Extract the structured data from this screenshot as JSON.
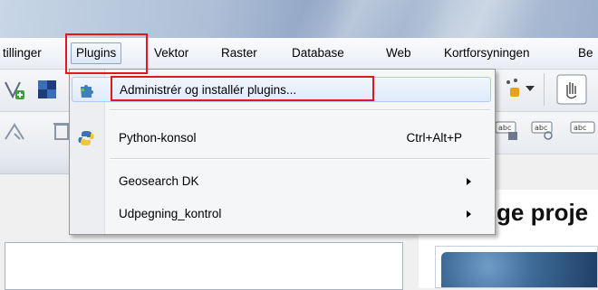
{
  "menubar": {
    "items": [
      {
        "label": "tillinger"
      },
      {
        "label": "Plugins"
      },
      {
        "label": "Vektor"
      },
      {
        "label": "Raster"
      },
      {
        "label": "Database"
      },
      {
        "label": "Web"
      },
      {
        "label": "Kortforsyningen"
      },
      {
        "label": "Be"
      }
    ]
  },
  "plugins_menu": {
    "items": [
      {
        "label": "Administrér og installér plugins...",
        "icon": "puzzle-icon"
      },
      {
        "label": "Python-konsol",
        "shortcut": "Ctrl+Alt+P",
        "icon": "python-icon"
      },
      {
        "label": "Geosearch DK",
        "submenu": true
      },
      {
        "label": "Udpegning_kontrol",
        "submenu": true
      }
    ]
  },
  "main": {
    "heading": "ge proje"
  },
  "colors": {
    "highlight_border": "#e3171e",
    "menu_hover": "#dfeafa"
  }
}
